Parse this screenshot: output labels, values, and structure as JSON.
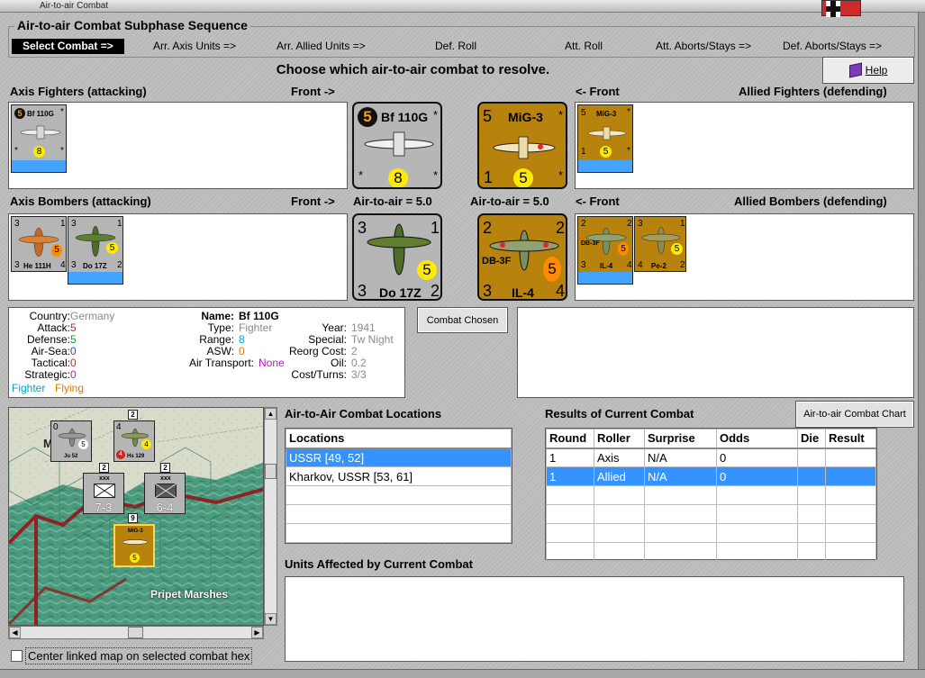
{
  "window": {
    "title": "Air-to-air Combat"
  },
  "sequence": {
    "title": "Air-to-air Combat Subphase Sequence",
    "phases": [
      {
        "label": "Select Combat =>",
        "active": true
      },
      {
        "label": "Arr. Axis Units =>"
      },
      {
        "label": "Arr. Allied Units =>"
      },
      {
        "label": "Def. Roll"
      },
      {
        "label": "Att. Roll"
      },
      {
        "label": "Att. Aborts/Stays =>"
      },
      {
        "label": "Def. Aborts/Stays =>"
      }
    ]
  },
  "prompt": "Choose which air-to-air combat to resolve.",
  "help": {
    "label": "Help",
    "icon": "help-book-icon"
  },
  "sections": {
    "axis_fighters": "Axis Fighters (attacking)",
    "front_right": "Front ->",
    "front_left": "<- Front",
    "allied_fighters": "Allied Fighters (defending)",
    "axis_bombers": "Axis Bombers (attacking)",
    "air_to_air_axis": "Air-to-air = 5.0",
    "air_to_air_allied": "Air-to-air = 5.0",
    "allied_bombers": "Allied Bombers (defending)"
  },
  "units": {
    "bf110": {
      "name": "Bf 110G",
      "left": "5",
      "tl_star": "*",
      "bl": "*",
      "br": "*",
      "center": "8"
    },
    "mig3": {
      "name": "MiG-3",
      "tl": "5",
      "tr": "*",
      "bl": "1",
      "br": "*",
      "center": "5"
    },
    "he111": {
      "name": "He 111H",
      "tl": "3",
      "tr": "1",
      "bl": "3",
      "br": "4",
      "center": "5"
    },
    "do17": {
      "name": "Do 17Z",
      "tl": "3",
      "tr": "1",
      "bl": "3",
      "br": "2",
      "center": "5"
    },
    "il4": {
      "name": "IL-4",
      "side": "DB-3F",
      "tl": "2",
      "tr": "2",
      "bl": "3",
      "br": "4",
      "center": "5"
    },
    "pe2": {
      "name": "Pe-2",
      "tl": "3",
      "tr": "1",
      "bl": "4",
      "br": "2",
      "center": "5"
    }
  },
  "info": {
    "country_label": "Country:",
    "country": "Germany",
    "attack_label": "Attack:",
    "attack": "5",
    "defense_label": "Defense:",
    "defense": "5",
    "airsea_label": "Air-Sea:",
    "airsea": "0",
    "tactical_label": "Tactical:",
    "tactical": "0",
    "strategic_label": "Strategic:",
    "strategic": "0",
    "class1": "Fighter",
    "class2": "Flying",
    "name_label": "Name:",
    "name": "Bf 110G",
    "type_label": "Type:",
    "type": "Fighter",
    "range_label": "Range:",
    "range": "8",
    "asw_label": "ASW:",
    "asw": "0",
    "airtransport_label": "Air Transport:",
    "airtransport": "None",
    "year_label": "Year:",
    "year": "1941",
    "special_label": "Special:",
    "special": "Tw Night",
    "reorg_label": "Reorg Cost:",
    "reorg": "2",
    "oil_label": "Oil:",
    "oil": "0.2",
    "cost_label": "Cost/Turns:",
    "cost": "3/3"
  },
  "combat_chosen": "Combat Chosen",
  "locations": {
    "title": "Air-to-Air Combat Locations",
    "header": "Locations",
    "rows": [
      "USSR [49, 52]",
      "Kharkov, USSR [53, 61]",
      "",
      "",
      "",
      ""
    ],
    "selected_index": 0
  },
  "results": {
    "title": "Results of Current Combat",
    "chart_button": "Air-to-air Combat Chart",
    "headers": [
      "Round",
      "Roller",
      "Surprise",
      "Odds",
      "Die",
      "Result"
    ],
    "rows": [
      [
        "1",
        "Axis",
        "N/A",
        "0",
        "",
        ""
      ],
      [
        "1",
        "Allied",
        "N/A",
        "0",
        "",
        ""
      ],
      [
        "",
        "",
        "",
        "",
        "",
        ""
      ],
      [
        "",
        "",
        "",
        "",
        "",
        ""
      ],
      [
        "",
        "",
        "",
        "",
        "",
        ""
      ],
      [
        "",
        "",
        "",
        "",
        "",
        ""
      ]
    ],
    "selected_index": 1
  },
  "affected": {
    "title": "Units Affected by Current Combat"
  },
  "map": {
    "region_label": "Pripet Marshes",
    "edge_letter": "M",
    "units": [
      {
        "name": "Ju 52",
        "tl": "0",
        "tr": "5",
        "stack": ""
      },
      {
        "name": "Hs 129",
        "tl": "4",
        "tr": "4",
        "badge": "4",
        "stack": "2"
      },
      {
        "name": "7-3",
        "size": "xxx",
        "stack": "2"
      },
      {
        "name": "6-4",
        "size": "xxx",
        "stack": "2"
      },
      {
        "name": "MiG-3",
        "stack": "9",
        "center": "5"
      }
    ]
  },
  "center_map": {
    "label": "Center linked map on selected combat hex",
    "checked": false
  },
  "colors": {
    "axis_counter": "#b5b5b5",
    "allied_counter": "#b8830c",
    "selection": "#3593ff"
  }
}
